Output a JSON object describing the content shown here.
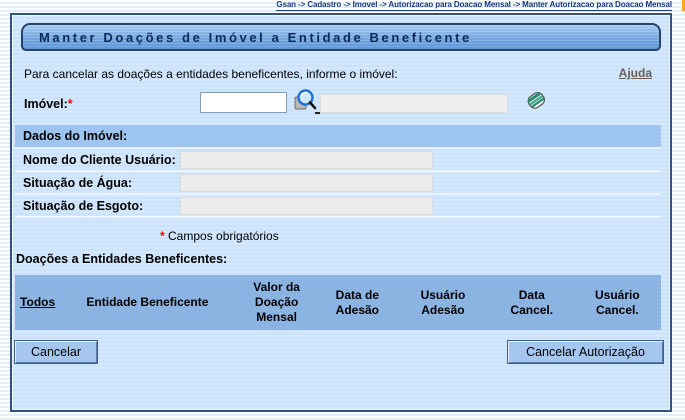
{
  "breadcrumb": "Gsan -> Cadastro -> Imovel -> Autorizacao para Doacao Mensal -> Manter Autorizacao para Doacao Mensal",
  "title": "Manter Doações de Imóvel a Entidade Beneficente",
  "help_link": "Ajuda",
  "instruction": "Para cancelar as doações a entidades beneficentes, informe o imóvel:",
  "imovel": {
    "label": "Imóvel:",
    "required_marker": "*",
    "value": "",
    "lookup_value": ""
  },
  "dados_imovel": {
    "header": "Dados do Imóvel:",
    "rows": [
      {
        "label": "Nome do Cliente Usuário:",
        "value": ""
      },
      {
        "label": "Situação de Água:",
        "value": ""
      },
      {
        "label": "Situação de Esgoto:",
        "value": ""
      }
    ]
  },
  "required_note": {
    "marker": "*",
    "text": " Campos obrigatórios"
  },
  "donations": {
    "label": "Doações a Entidades Beneficentes:",
    "columns": [
      "Todos",
      "Entidade Beneficente",
      "Valor da Doação Mensal",
      "Data de Adesão",
      "Usuário Adesão",
      "Data Cancel.",
      "Usuário Cancel."
    ],
    "rows": []
  },
  "buttons": {
    "cancel": "Cancelar",
    "cancel_authorization": "Cancelar Autorização"
  },
  "icons": [
    "search-icon",
    "eraser-icon"
  ],
  "colors": {
    "breadcrumb_text": "#16387c",
    "orange_mark": "#f6a821",
    "panel_border": "#33527e",
    "panel_bg": "#cde4fa",
    "title_bar_top": "#a7cbf0",
    "title_bar_bottom": "#5e96d8",
    "section_header_bg": "#9dc5f0",
    "table_header_bg": "#8cb4e2",
    "readonly_bg": "#ececec",
    "button_bg": "#a4c6ef",
    "required_red": "#ff0000",
    "help_link_color": "#686058"
  }
}
